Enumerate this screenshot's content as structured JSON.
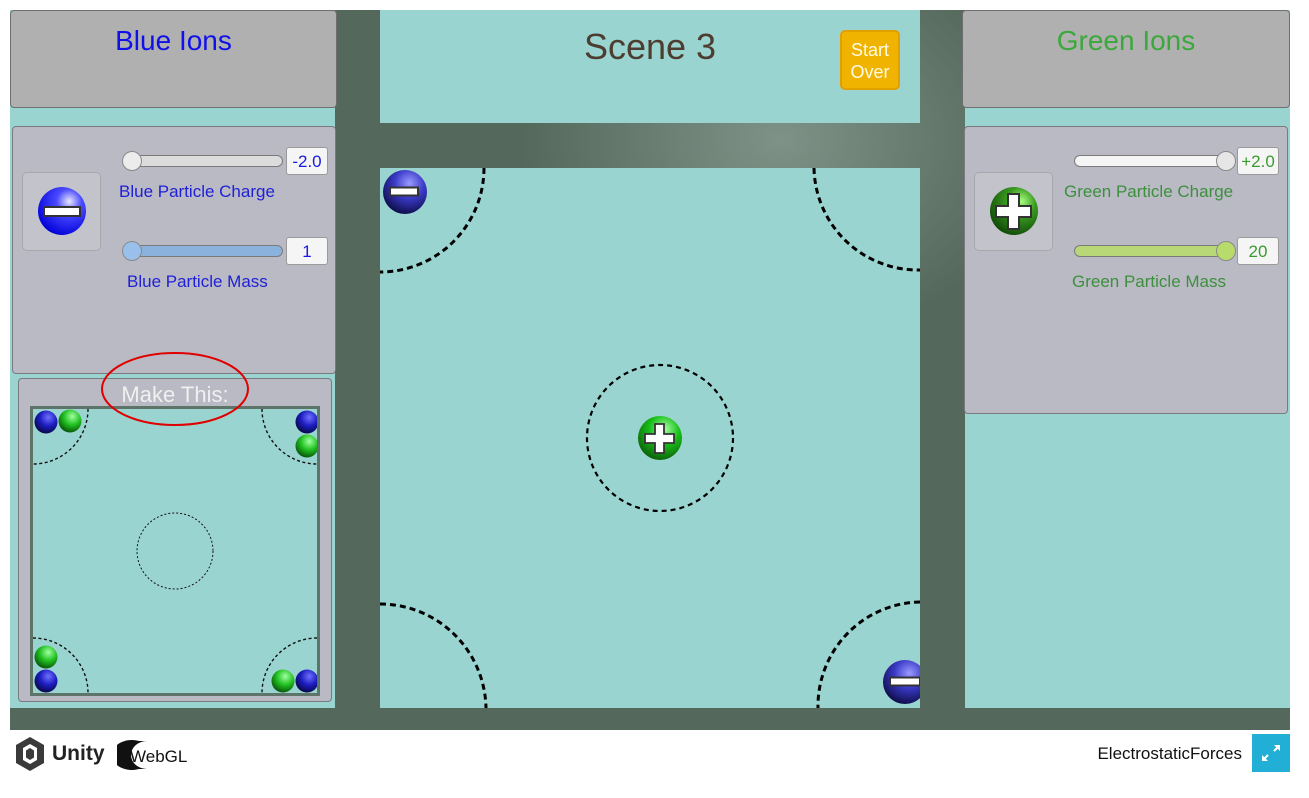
{
  "app": {
    "name": "ElectrostaticForces",
    "engine_logo": "Unity",
    "platform_logo": "WebGL"
  },
  "scene": {
    "title": "Scene 3",
    "start_over_line1": "Start",
    "start_over_line2": "Over"
  },
  "blue_panel": {
    "title": "Blue Ions",
    "title_color": "#1010e8",
    "icon": "blue-negative-ion-icon",
    "charge_label": "Blue Particle Charge",
    "charge_value": "-2.0",
    "charge_slider_fraction": 0.0,
    "mass_label": "Blue Particle Mass",
    "mass_value": "1",
    "mass_slider_fraction": 0.0
  },
  "green_panel": {
    "title": "Green Ions",
    "title_color": "#3aa83a",
    "icon": "green-positive-ion-icon",
    "charge_label": "Green Particle Charge",
    "charge_value": "+2.0",
    "charge_slider_fraction": 1.0,
    "mass_label": "Green Particle Mass",
    "mass_value": "20",
    "mass_slider_fraction": 1.0
  },
  "target": {
    "title": "Make This:",
    "annotation": "red-ellipse-highlight"
  },
  "colors": {
    "canvas_bg": "#55685c",
    "teal": "#9ad4d0",
    "start_over": "#f0b400",
    "fullscreen": "#22afd6",
    "highlight": "#e00000"
  }
}
